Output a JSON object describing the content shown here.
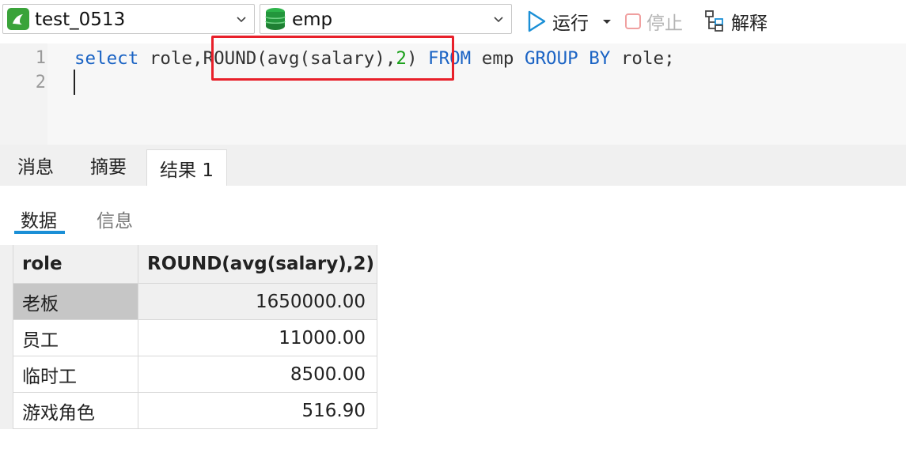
{
  "toolbar": {
    "connection": "test_0513",
    "database": "emp",
    "run_label": "运行",
    "stop_label": "停止",
    "explain_label": "解释"
  },
  "editor": {
    "line_numbers": [
      "1",
      "2"
    ],
    "tokens": {
      "select": "select",
      "role": " role,",
      "round": "ROUND(avg(salary),",
      "two": "2",
      "close": ")",
      "from": " FROM",
      "emp": " emp ",
      "group": "GROUP BY",
      "role_end": " role;"
    }
  },
  "result_tabs": [
    "消息",
    "摘要",
    "结果 1"
  ],
  "sub_tabs": [
    "数据",
    "信息"
  ],
  "table": {
    "columns": [
      "role",
      "ROUND(avg(salary),2)"
    ],
    "rows": [
      [
        "老板",
        "1650000.00"
      ],
      [
        "员工",
        "11000.00"
      ],
      [
        "临时工",
        "8500.00"
      ],
      [
        "游戏角色",
        "516.90"
      ]
    ]
  },
  "colors": {
    "keyword": "#1a63c4",
    "number": "#1aa01a",
    "highlight_box": "#e8202a",
    "accent": "#1a8fd6"
  }
}
